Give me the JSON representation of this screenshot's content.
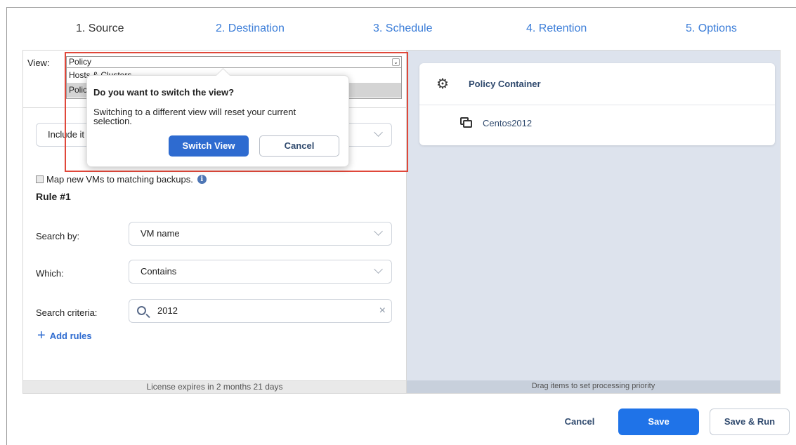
{
  "steps": [
    {
      "label": "1. Source",
      "active": true
    },
    {
      "label": "2. Destination"
    },
    {
      "label": "3. Schedule"
    },
    {
      "label": "4. Retention"
    },
    {
      "label": "5. Options"
    }
  ],
  "view": {
    "label": "View:",
    "selected": "Policy",
    "options": [
      "Hosts & Clusters",
      "Policy"
    ]
  },
  "include": {
    "value": "Include it"
  },
  "map": {
    "label": "Map new VMs to matching backups.",
    "info_icon": "info-icon"
  },
  "rule": {
    "title": "Rule #1",
    "search_by": {
      "label": "Search by:",
      "value": "VM name"
    },
    "which": {
      "label": "Which:",
      "value": "Contains"
    },
    "criteria": {
      "label": "Search criteria:",
      "value": "2012",
      "icon": "search-icon",
      "clear": "×"
    }
  },
  "add_rules": {
    "icon": "+",
    "label": "Add rules"
  },
  "left_footer": "License expires in 2 months 21 days",
  "right_footer": "Drag items to set processing priority",
  "container": {
    "icon": "gear-icon",
    "title": "Policy Container",
    "items": [
      {
        "icon": "vm-icon",
        "label": "Centos2012"
      }
    ]
  },
  "dialog": {
    "title": "Do you want to switch the view?",
    "message": "Switching to a different view will reset your current selection.",
    "confirm": "Switch View",
    "cancel": "Cancel"
  },
  "actions": {
    "cancel": "Cancel",
    "save": "Save",
    "save_run": "Save & Run"
  },
  "colors": {
    "accent": "#1f73e8",
    "highlight_border": "#e0473a",
    "right_panel_bg": "#dde3ed"
  }
}
